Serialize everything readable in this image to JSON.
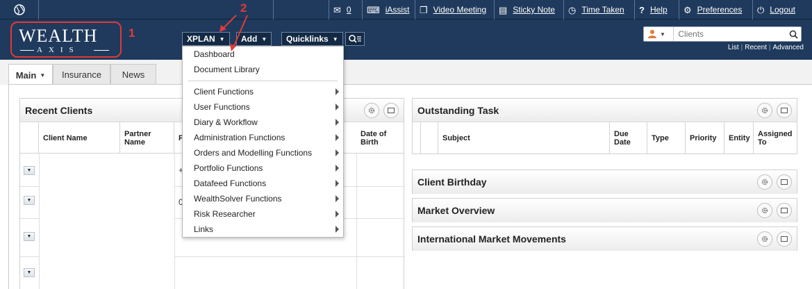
{
  "topbar": {
    "mail_count": "0",
    "iassist": "iAssist",
    "video_meeting": "Video Meeting",
    "sticky_note": "Sticky Note",
    "time_taken": "Time Taken",
    "help": "Help",
    "preferences": "Preferences",
    "logout": "Logout"
  },
  "logo": {
    "line1": "WEALTH",
    "line2": "AXIS"
  },
  "annotations": {
    "one": "1",
    "two": "2"
  },
  "nav": {
    "xplan": "XPLAN",
    "add": "Add",
    "quicklinks": "Quicklinks"
  },
  "search": {
    "placeholder": "Clients",
    "links": [
      "List",
      "Recent",
      "Advanced"
    ]
  },
  "tabs": [
    {
      "label": "Main",
      "active": true
    },
    {
      "label": "Insurance",
      "active": false
    },
    {
      "label": "News",
      "active": false
    }
  ],
  "recent_clients": {
    "title": "Recent Clients",
    "columns": [
      "Client Name",
      "Partner Name",
      "P",
      "Date of Birth"
    ],
    "row_fragments": [
      "+",
      "0"
    ]
  },
  "outstanding_task": {
    "title": "Outstanding Task",
    "columns": [
      "Subject",
      "Due Date",
      "Type",
      "Priority",
      "Entity",
      "Assigned To"
    ]
  },
  "panels": {
    "client_birthday": "Client Birthday",
    "market_overview": "Market Overview",
    "international_market": "International Market Movements"
  },
  "xplan_menu": {
    "top_items": [
      "Dashboard",
      "Document Library"
    ],
    "submenu_items": [
      "Client Functions",
      "User Functions",
      "Diary & Workflow",
      "Administration Functions",
      "Orders and Modelling Functions",
      "Portfolio Functions",
      "Datafeed Functions",
      "WealthSolver Functions",
      "Risk Researcher",
      "Links"
    ]
  },
  "colors": {
    "header": "#1f3a5c",
    "annotation": "#e03a3a"
  }
}
